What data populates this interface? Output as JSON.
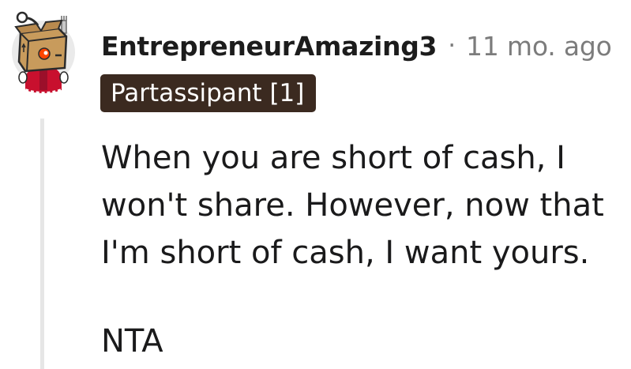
{
  "comment": {
    "username": "EntrepreneurAmazing3",
    "separator": "·",
    "timestamp": "11 mo. ago",
    "flair": "Partassipant [1]",
    "paragraphs": [
      "When you are short of cash, I won't share. However, now that I'm short of cash, I want yours.",
      "NTA"
    ]
  },
  "colors": {
    "flair_background": "#3b2a20",
    "meta_text": "#7c7c7c",
    "thread_line": "#e6e6e6"
  },
  "icons": {
    "avatar": "snoo-avatar-box-head-icon"
  }
}
